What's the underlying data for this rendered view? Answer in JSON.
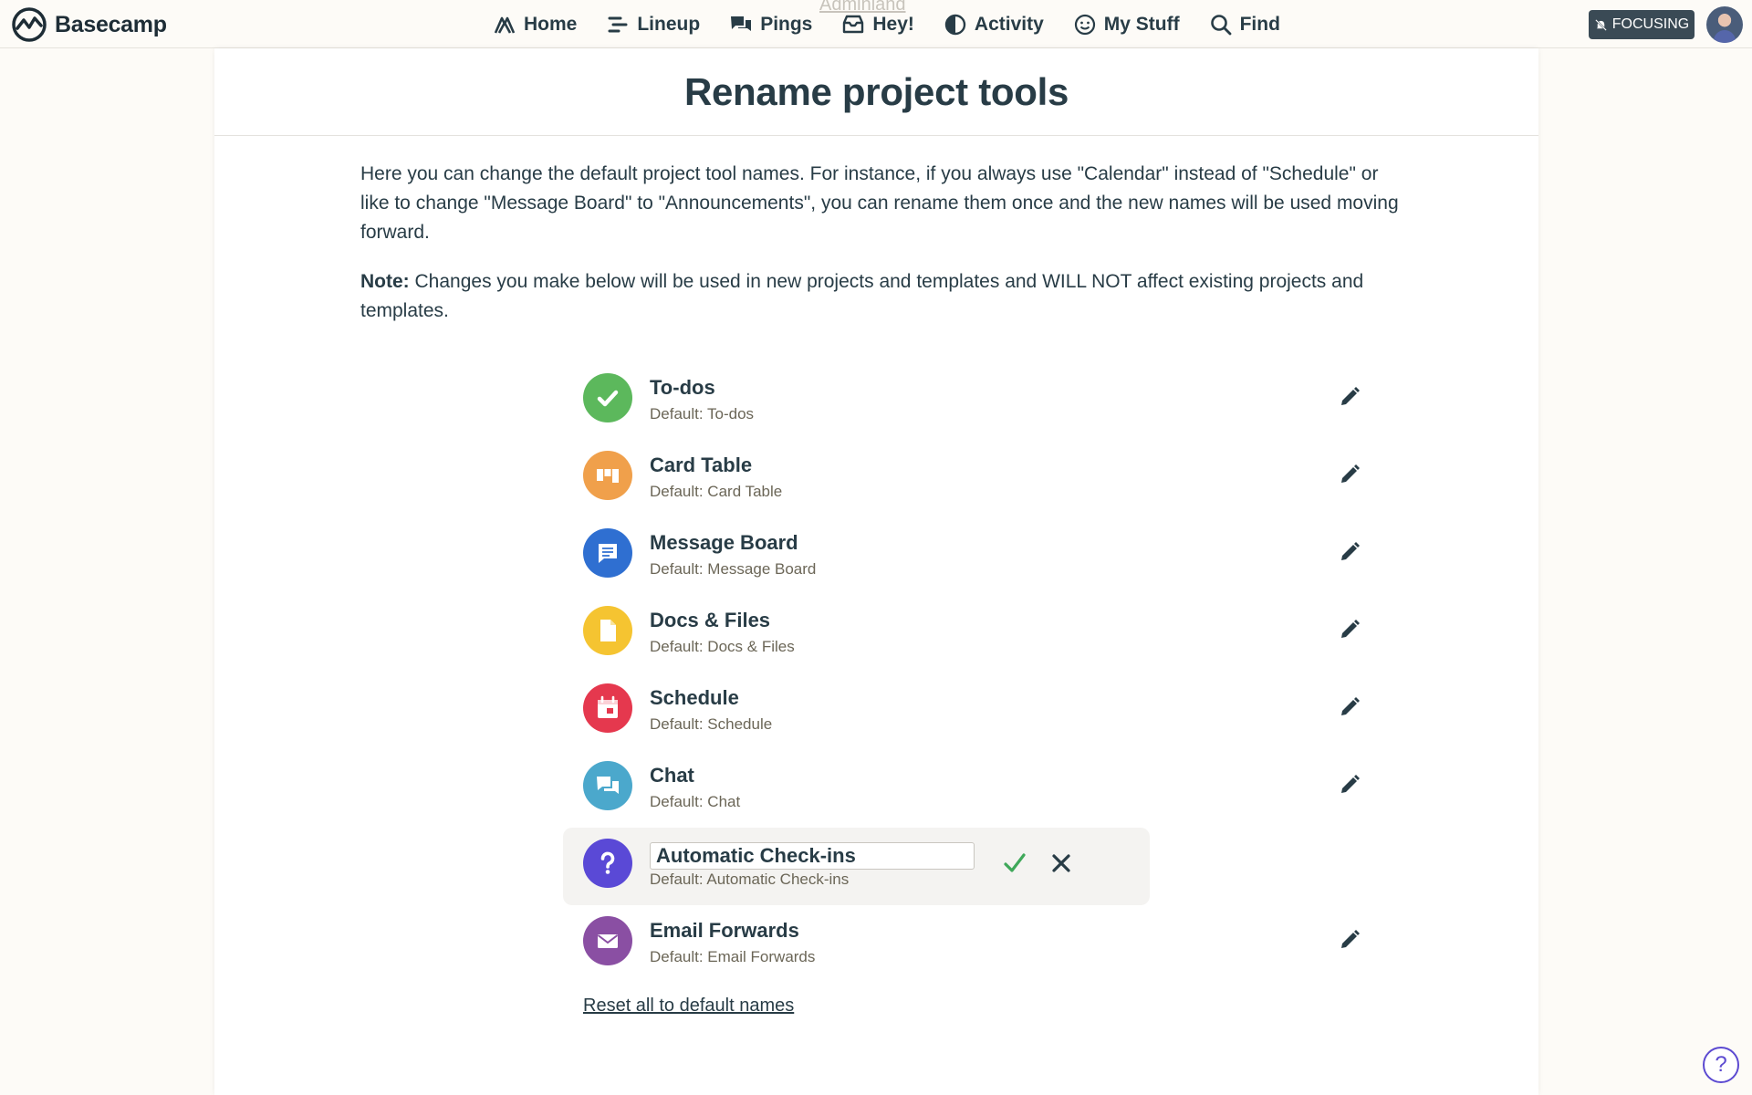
{
  "app": {
    "name": "Basecamp"
  },
  "nav": {
    "items": [
      {
        "label": "Home",
        "icon": "home-icon"
      },
      {
        "label": "Lineup",
        "icon": "lineup-icon"
      },
      {
        "label": "Pings",
        "icon": "pings-icon"
      },
      {
        "label": "Hey!",
        "icon": "hey-icon"
      },
      {
        "label": "Activity",
        "icon": "activity-icon"
      },
      {
        "label": "My Stuff",
        "icon": "my-stuff-icon"
      },
      {
        "label": "Find",
        "icon": "search-icon"
      }
    ],
    "adminland": "Adminland",
    "focusing_label": "FOCUSING"
  },
  "page": {
    "title": "Rename project tools",
    "intro": "Here you can change the default project tool names. For instance, if you always use \"Calendar\" instead of \"Schedule\" or like to change \"Message Board\" to \"Announcements\", you can rename them once and the new names will be used moving forward.",
    "note_label": "Note:",
    "note_text": " Changes you make below will be used in new projects and templates and WILL NOT affect existing projects and templates.",
    "reset_label": "Reset all to default names"
  },
  "tools": [
    {
      "name": "To-dos",
      "default": "Default: To-dos",
      "color": "#5cb85c",
      "icon": "check-icon"
    },
    {
      "name": "Card Table",
      "default": "Default: Card Table",
      "color": "#f0a04b",
      "icon": "card-table-icon"
    },
    {
      "name": "Message Board",
      "default": "Default: Message Board",
      "color": "#2f6fd1",
      "icon": "message-icon"
    },
    {
      "name": "Docs & Files",
      "default": "Default: Docs & Files",
      "color": "#f5c431",
      "icon": "document-icon"
    },
    {
      "name": "Schedule",
      "default": "Default: Schedule",
      "color": "#e5384e",
      "icon": "calendar-icon"
    },
    {
      "name": "Chat",
      "default": "Default: Chat",
      "color": "#4ba8cc",
      "icon": "chat-icon"
    },
    {
      "name": "Automatic Check-ins",
      "default": "Default: Automatic Check-ins",
      "color": "#5a49d6",
      "icon": "question-icon",
      "editing": true,
      "input_value": "Automatic Check-ins"
    },
    {
      "name": "Email Forwards",
      "default": "Default: Email Forwards",
      "color": "#8a4fa3",
      "icon": "email-icon"
    }
  ],
  "help": {
    "label": "?"
  }
}
